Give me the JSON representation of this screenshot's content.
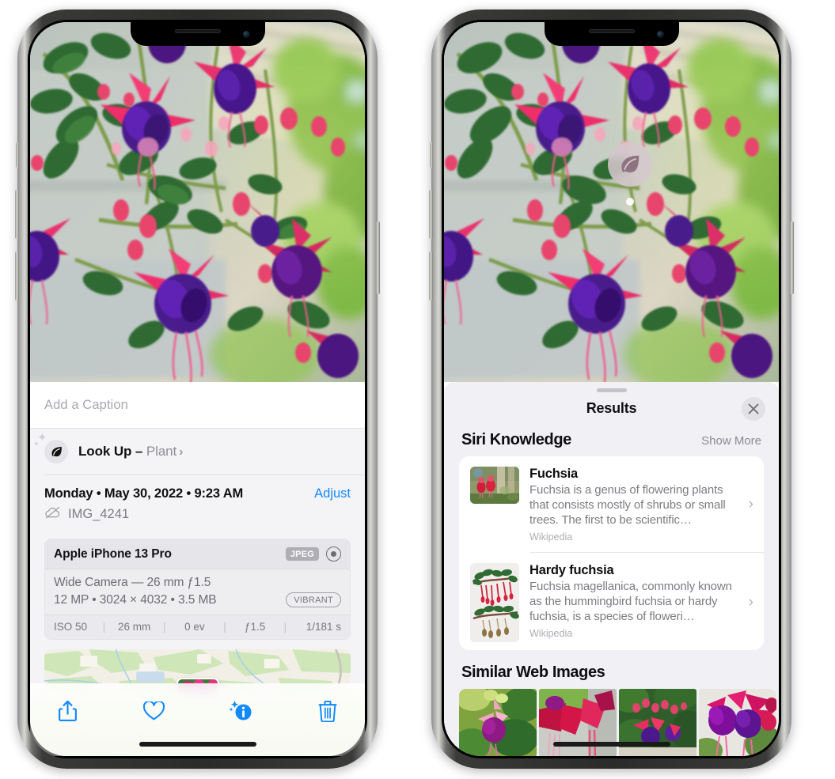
{
  "colors": {
    "accent_blue": "#1289fd",
    "sheet_bg": "#f1f0f5",
    "card_bg": "#ffffff",
    "muted_text": "#8e8e93",
    "tag_gray": "#aeaeb4"
  },
  "left_phone": {
    "caption_placeholder": "Add a Caption",
    "caption_value": "",
    "lookup": {
      "icon": "leaf-icon",
      "sparkle_icon": "sparkles-icon",
      "label": "Look Up – ",
      "subject": "Plant",
      "chevron": "›"
    },
    "date_line": "Monday • May 30, 2022 • 9:23 AM",
    "adjust_label": "Adjust",
    "file_icon": "icloud-slash-icon",
    "file_name": "IMG_4241",
    "camera_card": {
      "model": "Apple iPhone 13 Pro",
      "format_tag": "JPEG",
      "raw_icon": "raw-target-icon",
      "lens_line": "Wide Camera — 26 mm ƒ1.5",
      "specs_line": "12 MP  •  3024 × 4032  •  3.5 MB",
      "style_tag": "VIBRANT",
      "exif": [
        "ISO 50",
        "26 mm",
        "0 ev",
        "ƒ1.5",
        "1/181 s"
      ],
      "exif_separator": "|"
    },
    "toolbar": [
      {
        "name": "share-button",
        "icon": "share-icon"
      },
      {
        "name": "favorite-button",
        "icon": "heart-icon"
      },
      {
        "name": "info-button",
        "icon": "info-sparkle-icon"
      },
      {
        "name": "delete-button",
        "icon": "trash-icon"
      }
    ]
  },
  "right_phone": {
    "visual_lookup_badge": {
      "icon": "leaf-icon"
    },
    "sheet": {
      "grabber": "drag-handle",
      "title": "Results",
      "close_icon": "close-icon"
    },
    "siri_knowledge": {
      "section_title": "Siri Knowledge",
      "show_more": "Show More",
      "items": [
        {
          "title": "Fuchsia",
          "description": "Fuchsia is a genus of flowering plants that consists mostly of shrubs or small trees. The first to be scientific…",
          "source": "Wikipedia",
          "thumb": "fuchsia-red-flowers-thumb",
          "chevron": "›"
        },
        {
          "title": "Hardy fuchsia",
          "description": "Fuchsia magellanica, commonly known as the hummingbird fuchsia or hardy fuchsia, is a species of floweri…",
          "source": "Wikipedia",
          "thumb": "hardy-fuchsia-specimen-thumb",
          "chevron": "›"
        }
      ]
    },
    "similar_web_images": {
      "section_title": "Similar Web Images",
      "items": [
        {
          "name": "similar-image-1"
        },
        {
          "name": "similar-image-2"
        },
        {
          "name": "similar-image-3"
        },
        {
          "name": "similar-image-4"
        }
      ]
    }
  }
}
